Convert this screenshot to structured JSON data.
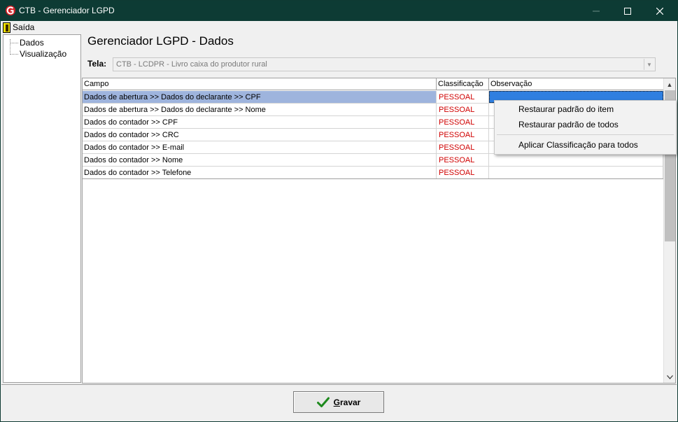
{
  "window": {
    "title": "CTB - Gerenciador LGPD"
  },
  "menubar": {
    "exit_label": "Saída"
  },
  "tree": {
    "items": [
      "Dados",
      "Visualização"
    ]
  },
  "main": {
    "title": "Gerenciador LGPD - Dados",
    "tela_label": "Tela:",
    "tela_value": "CTB - LCDPR - Livro caixa do produtor rural"
  },
  "grid": {
    "columns": [
      "Campo",
      "Classificação",
      "Observação"
    ],
    "rows": [
      {
        "campo": "Dados de abertura >>  Dados do declarante  >> CPF",
        "classificacao": "PESSOAL",
        "observacao": ""
      },
      {
        "campo": "Dados de abertura >>  Dados do declarante  >> Nome",
        "classificacao": "PESSOAL",
        "observacao": ""
      },
      {
        "campo": "Dados do contador >> CPF",
        "classificacao": "PESSOAL",
        "observacao": ""
      },
      {
        "campo": "Dados do contador >> CRC",
        "classificacao": "PESSOAL",
        "observacao": ""
      },
      {
        "campo": "Dados do contador >> E-mail",
        "classificacao": "PESSOAL",
        "observacao": ""
      },
      {
        "campo": "Dados do contador >> Nome",
        "classificacao": "PESSOAL",
        "observacao": ""
      },
      {
        "campo": "Dados do contador >> Telefone",
        "classificacao": "PESSOAL",
        "observacao": ""
      }
    ]
  },
  "context_menu": {
    "items": [
      "Restaurar padrão do item",
      "Restaurar padrão de todos",
      "Aplicar Classificação para todos"
    ]
  },
  "footer": {
    "save_label_first": "G",
    "save_label_rest": "ravar"
  },
  "colors": {
    "titlebar": "#0d3b34",
    "selected_row": "#9eb4dd",
    "selected_cell": "#2f7fe0",
    "classification_text": "#d00000"
  }
}
